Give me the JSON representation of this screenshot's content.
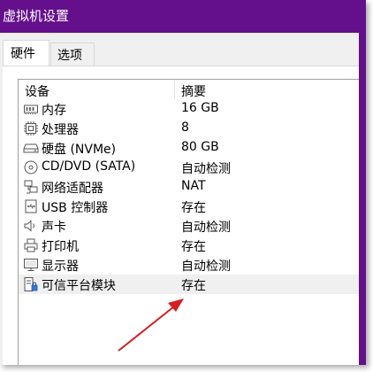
{
  "window": {
    "title": "虚拟机设置"
  },
  "tabs": [
    {
      "label": "硬件"
    },
    {
      "label": "选项"
    }
  ],
  "table": {
    "headers": [
      "设备",
      "摘要"
    ],
    "rows": [
      {
        "device": "内存",
        "summary": "16 GB",
        "icon": "memory-icon"
      },
      {
        "device": "处理器",
        "summary": "8",
        "icon": "processor-icon"
      },
      {
        "device": "硬盘 (NVMe)",
        "summary": "80 GB",
        "icon": "hard-disk-icon"
      },
      {
        "device": "CD/DVD (SATA)",
        "summary": "自动检测",
        "icon": "cd-dvd-icon"
      },
      {
        "device": "网络适配器",
        "summary": "NAT",
        "icon": "network-adapter-icon"
      },
      {
        "device": "USB 控制器",
        "summary": "存在",
        "icon": "usb-controller-icon"
      },
      {
        "device": "声卡",
        "summary": "自动检测",
        "icon": "sound-card-icon"
      },
      {
        "device": "打印机",
        "summary": "存在",
        "icon": "printer-icon"
      },
      {
        "device": "显示器",
        "summary": "自动检测",
        "icon": "display-icon"
      },
      {
        "device": "可信平台模块",
        "summary": "存在",
        "icon": "tpm-icon"
      }
    ]
  },
  "colors": {
    "titlebar": "#640f8c",
    "annotation_arrow": "#d81e1e"
  }
}
